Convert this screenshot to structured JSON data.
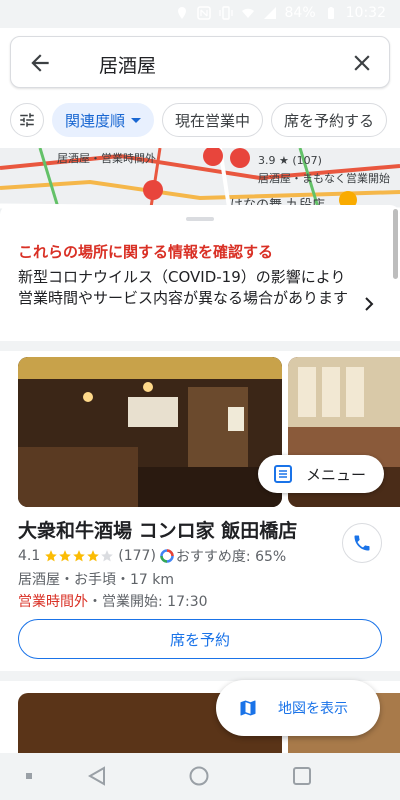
{
  "status_bar": {
    "battery": "84%",
    "time": "10:32"
  },
  "search": {
    "query": "居酒屋"
  },
  "chips": [
    {
      "label": "関連度順"
    },
    {
      "label": "現在営業中"
    },
    {
      "label": "席を予約する"
    }
  ],
  "map": {
    "labels": [
      "居酒屋・営業時間外",
      "3.9 ★ (107)",
      "居酒屋・まもなく営業開始",
      "はなの舞 九段店"
    ]
  },
  "covid": {
    "title": "これらの場所に関する情報を確認する",
    "body": "新型コロナウイルス（COVID-19）の影響により営業時間やサービス内容が異なる場合があります"
  },
  "place": {
    "name": "大衆和牛酒場 コンロ家 飯田橋店",
    "rating": "4.1",
    "reviews": "(177)",
    "recommend": "おすすめ度: 65%",
    "meta": "居酒屋・お手頃・17 km",
    "hours_status": "営業時間外",
    "hours_detail": "・営業開始: 17:30",
    "menu_label": "メニュー",
    "reserve_label": "席を予約",
    "stars_filled": 4
  },
  "map_button": {
    "label": "地図を表示"
  },
  "colors": {
    "accent": "#1a73e8",
    "warning": "#d93025",
    "star": "#fbbc04"
  }
}
